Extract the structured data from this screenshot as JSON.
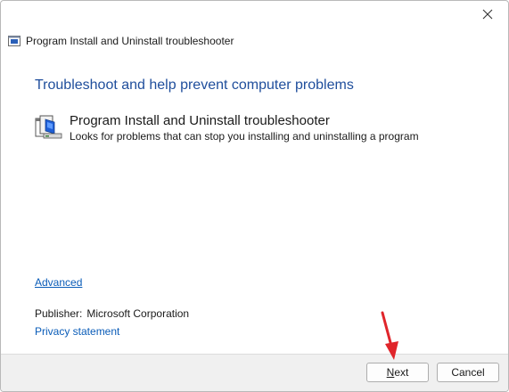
{
  "window": {
    "title": "Program Install and Uninstall troubleshooter",
    "close_icon": "close-icon"
  },
  "main": {
    "heading": "Troubleshoot and help prevent computer problems",
    "item": {
      "title": "Program Install and Uninstall troubleshooter",
      "description": "Looks for problems that can stop you installing and uninstalling a program",
      "icon": "troubleshooter-icon"
    },
    "advanced_link": "Advanced",
    "publisher_label": "Publisher:",
    "publisher_value": "Microsoft Corporation",
    "privacy_link": "Privacy statement"
  },
  "footer": {
    "next_mnemonic": "N",
    "next_rest": "ext",
    "cancel_label": "Cancel"
  },
  "colors": {
    "heading": "#1f4e9c",
    "link": "#0a5cb8",
    "annotation_arrow": "#e0252b"
  }
}
